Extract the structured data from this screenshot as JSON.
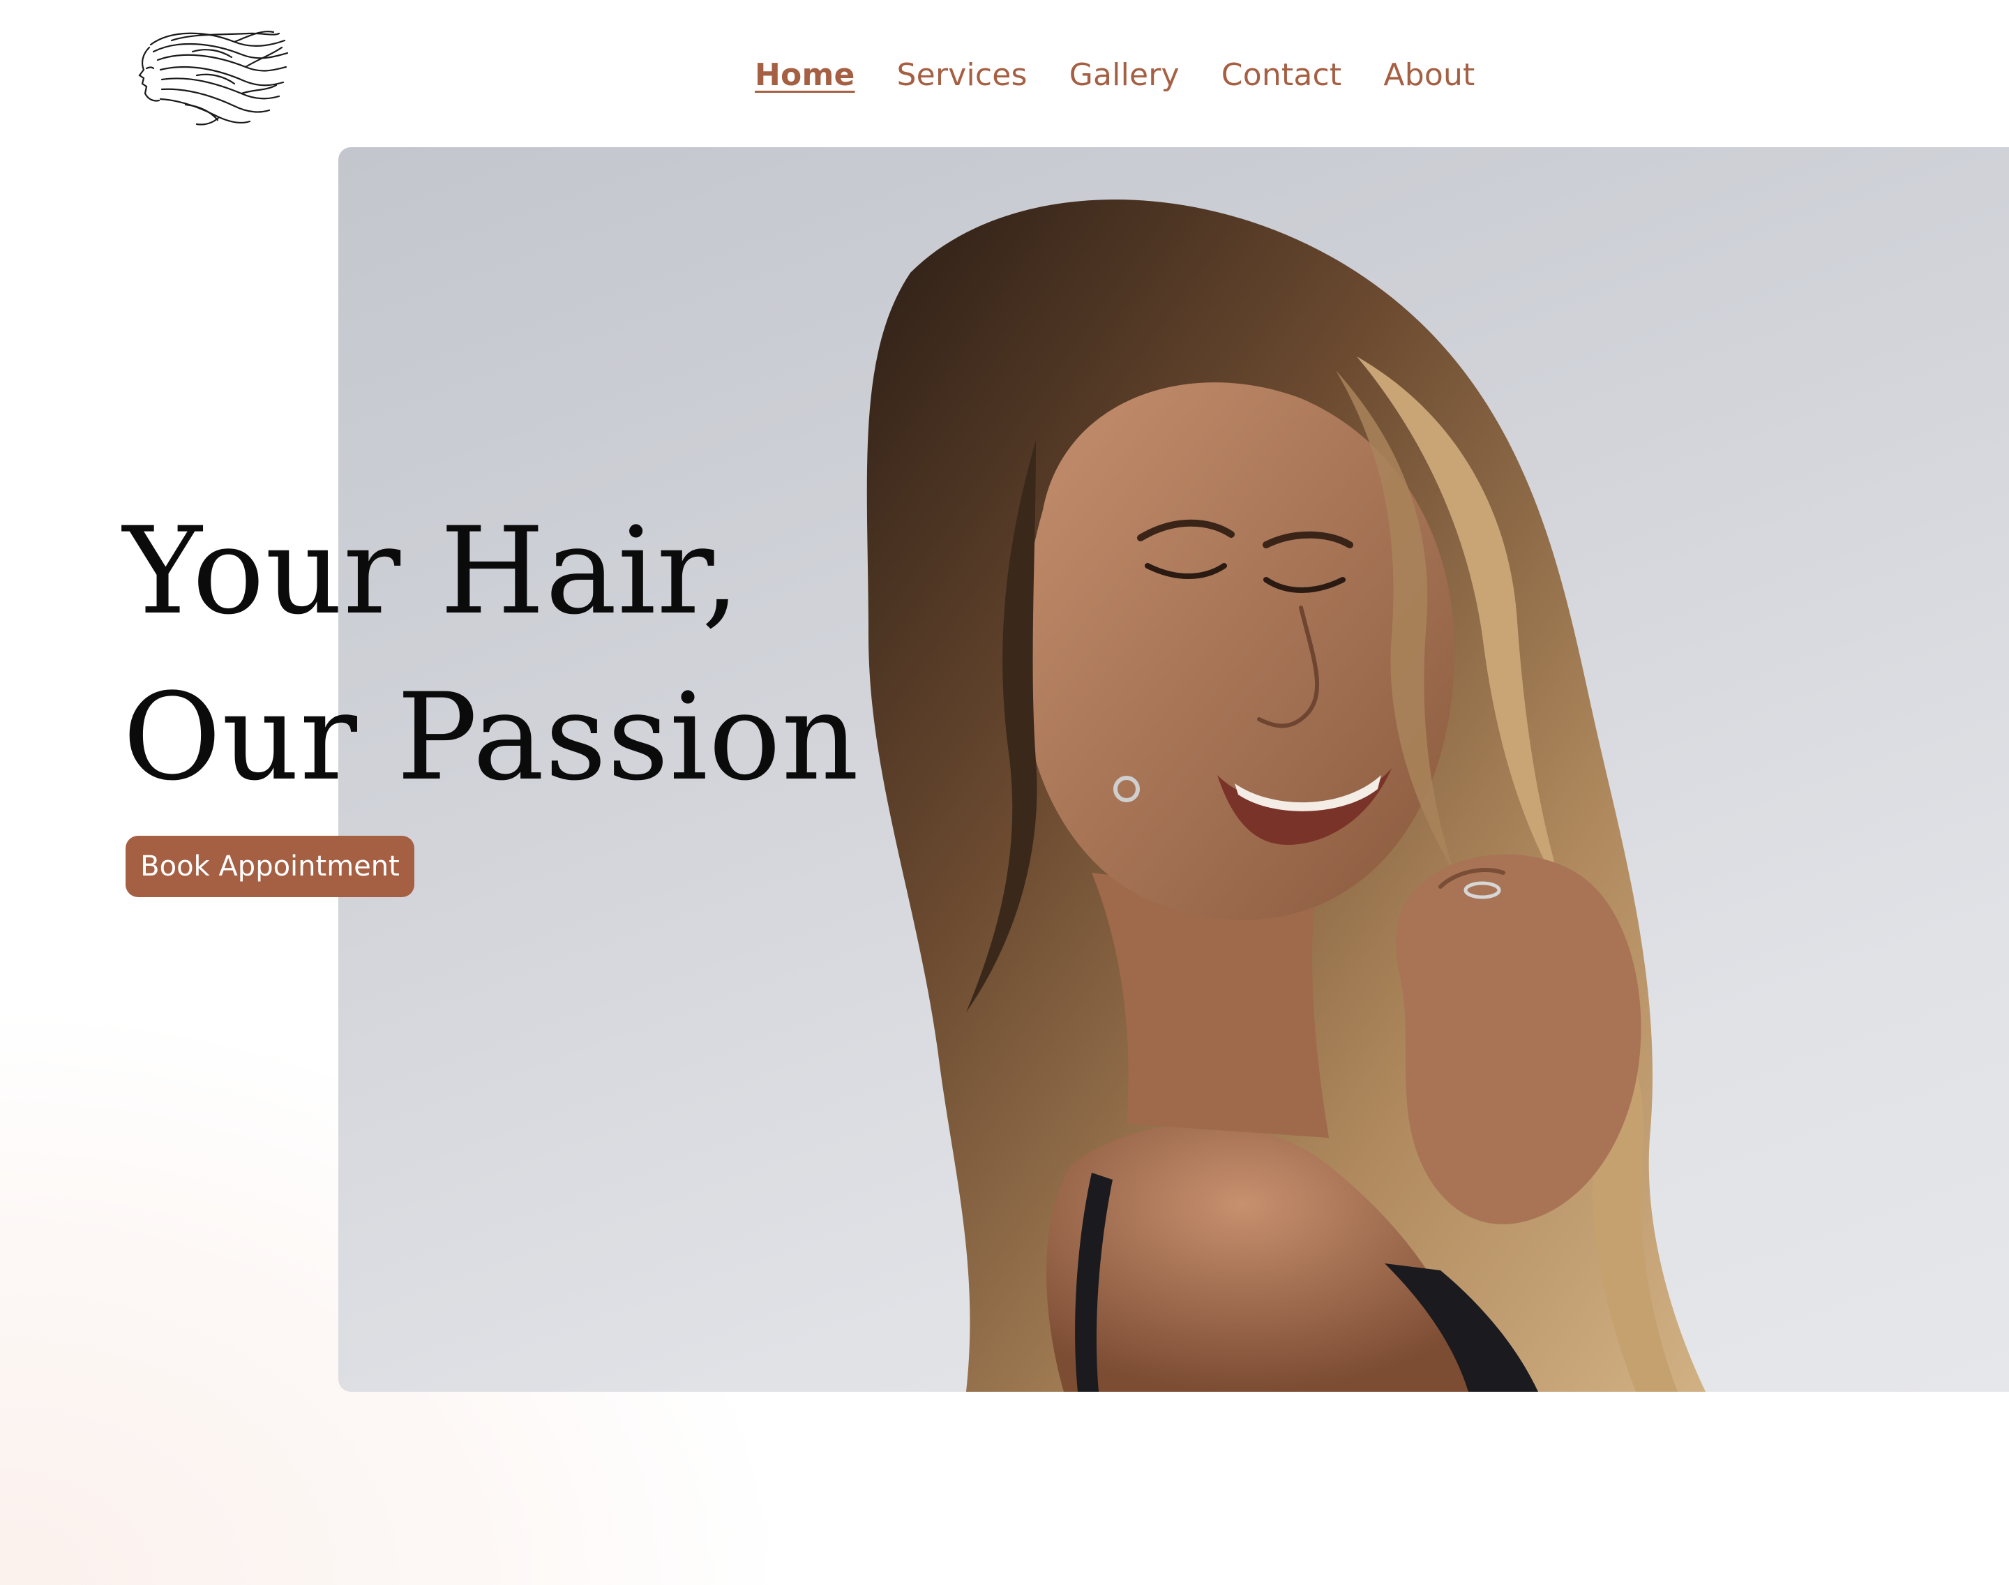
{
  "brand": {
    "logo_icon": "flowing-hair-woman-profile-logo"
  },
  "nav": {
    "items": [
      {
        "label": "Home",
        "active": true
      },
      {
        "label": "Services",
        "active": false
      },
      {
        "label": "Gallery",
        "active": false
      },
      {
        "label": "Contact",
        "active": false
      },
      {
        "label": "About",
        "active": false
      }
    ]
  },
  "hero": {
    "headline_line1": "Your Hair,",
    "headline_line2": "Our Passion",
    "cta_label": "Book Appointment",
    "image_subject": "woman-with-long-wavy-hair-photo"
  },
  "colors": {
    "accent": "#a55f43",
    "text": "#0b0b0b",
    "background": "#ffffff",
    "photo_backdrop": "#d2d4da"
  }
}
